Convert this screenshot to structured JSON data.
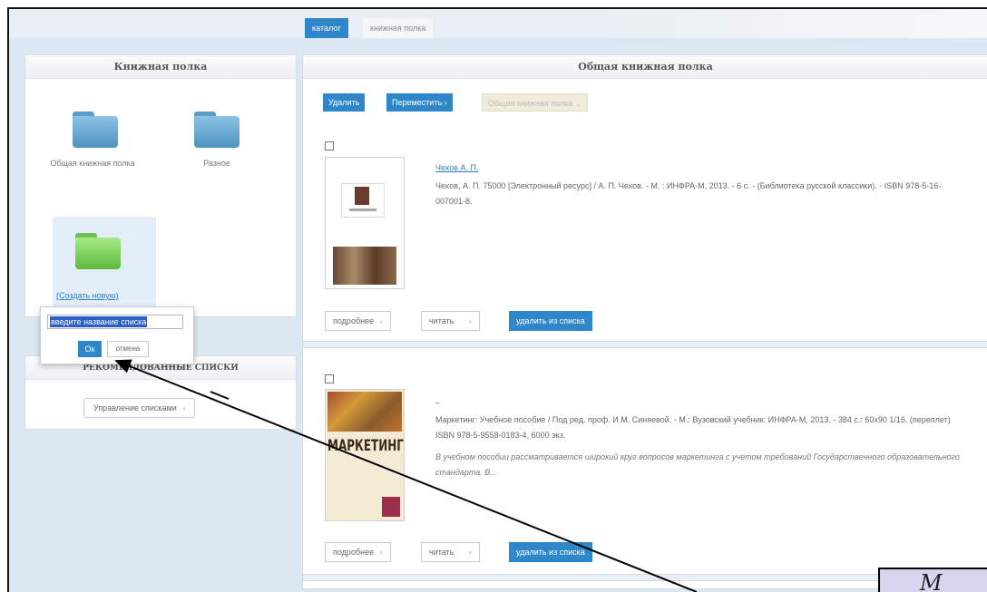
{
  "tabs": {
    "catalog": "каталог",
    "bookshelf": "книжная полка"
  },
  "left_panel": {
    "title": "Книжная полка",
    "folders": [
      {
        "label": "Общая книжная полка",
        "color": "blue"
      },
      {
        "label": "Разное",
        "color": "blue"
      }
    ],
    "create_new": "(Создать новую)"
  },
  "popup": {
    "input_value": "введите название списка",
    "ok": "Ок",
    "cancel": "отмена"
  },
  "recommended": {
    "title": "Рекомендованные списки",
    "manage_button": "Управление списками"
  },
  "main_panel": {
    "title": "Общая книжная полка",
    "toolbar": {
      "delete": "Удалить",
      "move": "Переместить",
      "target_select": "Общая книжная полка"
    },
    "items": [
      {
        "author": "Чехов А. П.",
        "description": "Чехов, А. П. 75000 [Электронный ресурс] / А. П. Чехов. - М. : ИНФРА-М, 2013. - 6 с. - (Библиотека русской классики). - ISBN 978-5-16-007001-8.",
        "annotation": "",
        "buttons": {
          "details": "подробнее",
          "read": "читать",
          "remove": "удалить из списка"
        }
      },
      {
        "author": "–",
        "description": "Маркетинг: Учебное пособие / Под ред. проф. И.М. Синяевой. - М.: Вузовский учебник: ИНФРА-М, 2013. - 384 с.: 60x90 1/16. (переплет) ISBN 978-5-9558-0183-4, 6000 экз.",
        "annotation": "В учебном пособии рассматривается широкий круг вопросов маркетинга с учетом требований Государственного образовательного стандарта. В...",
        "buttons": {
          "details": "подробнее",
          "read": "читать",
          "remove": "удалить из списка"
        }
      }
    ]
  },
  "corner_label": "М",
  "colors": {
    "accent": "#2f86c9",
    "background": "#dce8f3",
    "folder_blue": "#6aa8d4",
    "folder_green": "#7fd35e",
    "corner_box": "#d7d5ed"
  }
}
